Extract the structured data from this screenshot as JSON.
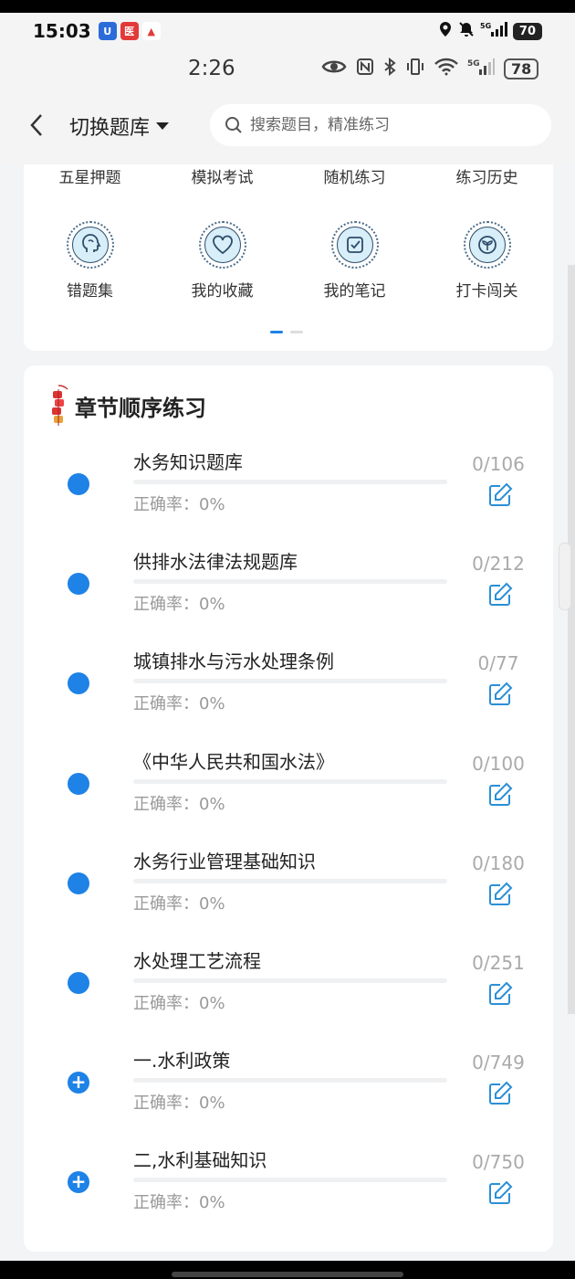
{
  "status": {
    "time": "15:03",
    "apps": [
      "U",
      "医",
      "▲"
    ],
    "battery": "70",
    "net": "5G"
  },
  "status2": {
    "time": "2:26",
    "net": "5G",
    "battery": "78"
  },
  "header": {
    "switch_label": "切换题库",
    "search_placeholder": "搜索题目，精准练习"
  },
  "quick": {
    "row1": [
      "五星押题",
      "模拟考试",
      "随机练习",
      "练习历史"
    ],
    "row2": [
      {
        "label": "错题集",
        "icon": "head-icon"
      },
      {
        "label": "我的收藏",
        "icon": "heart-icon"
      },
      {
        "label": "我的笔记",
        "icon": "notebook-icon"
      },
      {
        "label": "打卡闯关",
        "icon": "sprout-icon"
      }
    ],
    "pager_active": 0
  },
  "section": {
    "title": "章节顺序练习"
  },
  "chapters": [
    {
      "name": "水务知识题库",
      "accuracy": "正确率：0%",
      "count": "0/106",
      "progress": 0,
      "expandable": false
    },
    {
      "name": "供排水法律法规题库",
      "accuracy": "正确率：0%",
      "count": "0/212",
      "progress": 0,
      "expandable": false
    },
    {
      "name": "城镇排水与污水处理条例",
      "accuracy": "正确率：0%",
      "count": "0/77",
      "progress": 0,
      "expandable": false
    },
    {
      "name": "《中华人民共和国水法》",
      "accuracy": "正确率：0%",
      "count": "0/100",
      "progress": 0,
      "expandable": false
    },
    {
      "name": "水务行业管理基础知识",
      "accuracy": "正确率：0%",
      "count": "0/180",
      "progress": 0,
      "expandable": false
    },
    {
      "name": "水处理工艺流程",
      "accuracy": "正确率：0%",
      "count": "0/251",
      "progress": 0,
      "expandable": false
    },
    {
      "name": "一.水利政策",
      "accuracy": "正确率：0%",
      "count": "0/749",
      "progress": 0,
      "expandable": true
    },
    {
      "name": "二,水利基础知识",
      "accuracy": "正确率：0%",
      "count": "0/750",
      "progress": 0,
      "expandable": true
    }
  ],
  "colors": {
    "accent": "#1e82e6",
    "edit_icon": "#2a8fd6"
  }
}
